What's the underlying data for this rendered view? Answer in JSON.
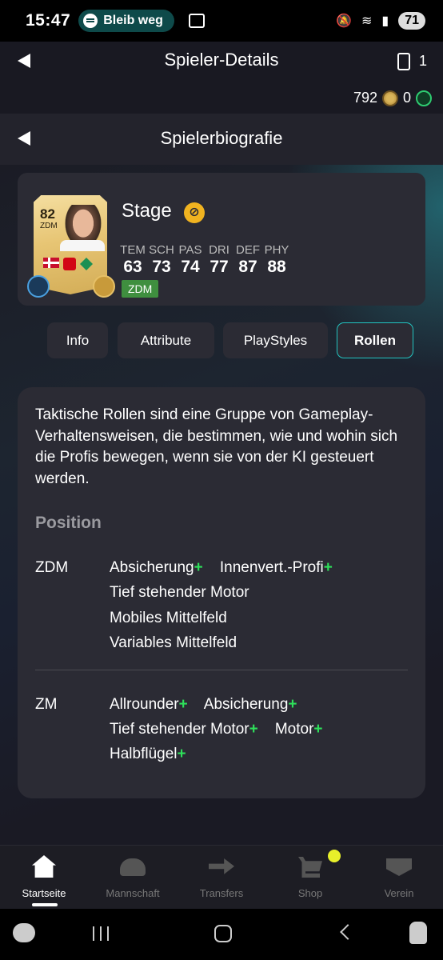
{
  "status_bar": {
    "time": "15:47",
    "media_label": "Bleib weg",
    "battery": "71"
  },
  "header": {
    "title": "Spieler-Details",
    "card_count": "1",
    "coins": "792",
    "points": "0"
  },
  "subheader": {
    "title": "Spielerbiografie"
  },
  "player": {
    "rating": "82",
    "position": "ZDM",
    "name": "Stage",
    "stats": [
      {
        "label": "TEM",
        "value": "63"
      },
      {
        "label": "SCH",
        "value": "73"
      },
      {
        "label": "PAS",
        "value": "74"
      },
      {
        "label": "DRI",
        "value": "77"
      },
      {
        "label": "DEF",
        "value": "87"
      },
      {
        "label": "PHY",
        "value": "88"
      }
    ],
    "position_badge": "ZDM"
  },
  "tabs": [
    {
      "label": "Info",
      "active": false
    },
    {
      "label": "Attribute",
      "active": false
    },
    {
      "label": "PlayStyles",
      "active": false
    },
    {
      "label": "Rollen",
      "active": true
    }
  ],
  "roles": {
    "description": "Taktische Rollen sind eine Gruppe von Gameplay-Verhaltensweisen, die bestimmen, wie und wohin sich die Profis bewegen, wenn sie von der KI gesteuert werden.",
    "section_title": "Position",
    "groups": [
      {
        "position": "ZDM",
        "lines": [
          [
            {
              "name": "Absicherung",
              "plus": "+"
            },
            {
              "name": "Innenvert.-Profi",
              "plus": "+"
            }
          ],
          [
            {
              "name": "Tief stehender Motor",
              "plus": ""
            }
          ],
          [
            {
              "name": "Mobiles Mittelfeld",
              "plus": ""
            }
          ],
          [
            {
              "name": "Variables Mittelfeld",
              "plus": ""
            }
          ]
        ]
      },
      {
        "position": "ZM",
        "lines": [
          [
            {
              "name": "Allrounder",
              "plus": "+"
            },
            {
              "name": "Absicherung",
              "plus": "+"
            }
          ],
          [
            {
              "name": "Tief stehender Motor",
              "plus": "+"
            },
            {
              "name": "Motor",
              "plus": "+"
            }
          ],
          [
            {
              "name": "Halbflügel",
              "plus": "+"
            }
          ]
        ]
      }
    ]
  },
  "bottom_nav": [
    {
      "label": "Startseite",
      "icon": "home-icon",
      "active": true
    },
    {
      "label": "Mannschaft",
      "icon": "team-icon",
      "active": false
    },
    {
      "label": "Transfers",
      "icon": "transfer-icon",
      "active": false
    },
    {
      "label": "Shop",
      "icon": "shop-icon",
      "active": false
    },
    {
      "label": "Verein",
      "icon": "club-icon",
      "active": false
    }
  ]
}
